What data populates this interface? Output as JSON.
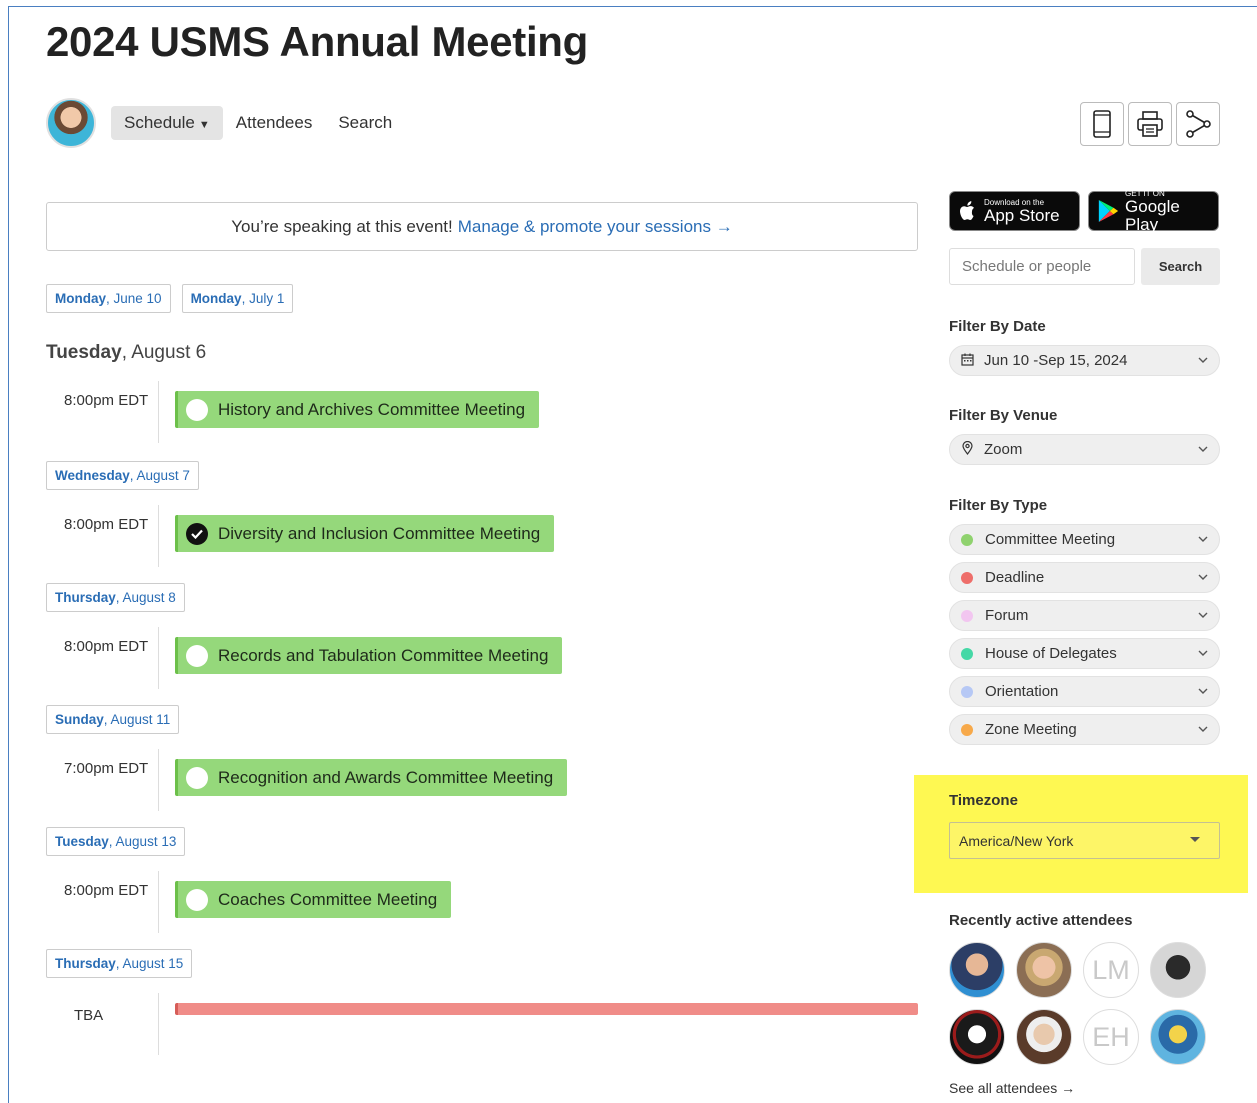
{
  "title": "2024 USMS Annual Meeting",
  "nav": {
    "schedule_label": "Schedule",
    "attendees_label": "Attendees",
    "search_label": "Search"
  },
  "banner": {
    "text": "You’re speaking at this event!",
    "link": "Manage & promote your sessions →"
  },
  "date_tabs": [
    {
      "day": "Monday",
      "date": ", June 10"
    },
    {
      "day": "Monday",
      "date": ", July 1"
    }
  ],
  "current_day": {
    "day": "Tuesday",
    "date": ", August 6"
  },
  "days": [
    {
      "chip_day": "",
      "chip_date": "",
      "time": "8:00pm EDT",
      "event": "History and Archives Committee Meeting",
      "checked": false
    },
    {
      "chip_day": "Wednesday",
      "chip_date": ", August 7",
      "time": "8:00pm EDT",
      "event": "Diversity and Inclusion Committee Meeting",
      "checked": true
    },
    {
      "chip_day": "Thursday",
      "chip_date": ", August 8",
      "time": "8:00pm EDT",
      "event": "Records and Tabulation Committee Meeting",
      "checked": false
    },
    {
      "chip_day": "Sunday",
      "chip_date": ", August 11",
      "time": "7:00pm EDT",
      "event": "Recognition and Awards Committee Meeting",
      "checked": false
    },
    {
      "chip_day": "Tuesday",
      "chip_date": ", August 13",
      "time": "8:00pm EDT",
      "event": "Coaches Committee Meeting",
      "checked": false
    },
    {
      "chip_day": "Thursday",
      "chip_date": ", August 15",
      "time": "TBA",
      "event": "",
      "checked": false
    }
  ],
  "stores": {
    "apple_small": "Download on the",
    "apple_big": "App Store",
    "google_small": "GET IT ON",
    "google_big": "Google Play"
  },
  "sidebar_search": {
    "placeholder": "Schedule or people",
    "button": "Search"
  },
  "filter_date": {
    "title": "Filter By Date",
    "value": "Jun 10 -Sep 15, 2024"
  },
  "filter_venue": {
    "title": "Filter By Venue",
    "value": "Zoom"
  },
  "filter_type": {
    "title": "Filter By Type",
    "items": [
      {
        "label": "Committee Meeting",
        "color": "#8fd26e"
      },
      {
        "label": "Deadline",
        "color": "#ee6e6a"
      },
      {
        "label": "Forum",
        "color": "#f2c6f0"
      },
      {
        "label": "House of Delegates",
        "color": "#45d8a6"
      },
      {
        "label": "Orientation",
        "color": "#b6c8f5"
      },
      {
        "label": "Zone Meeting",
        "color": "#f7a94a"
      }
    ]
  },
  "timezone": {
    "title": "Timezone",
    "value": "America/New York"
  },
  "recent": {
    "title": "Recently active attendees",
    "initials": [
      "LM",
      "EH"
    ],
    "see_all": "See all attendees →"
  },
  "colors": {
    "accent": "#2a6db5",
    "event_green": "#95d87b",
    "highlight": "#fef852"
  }
}
